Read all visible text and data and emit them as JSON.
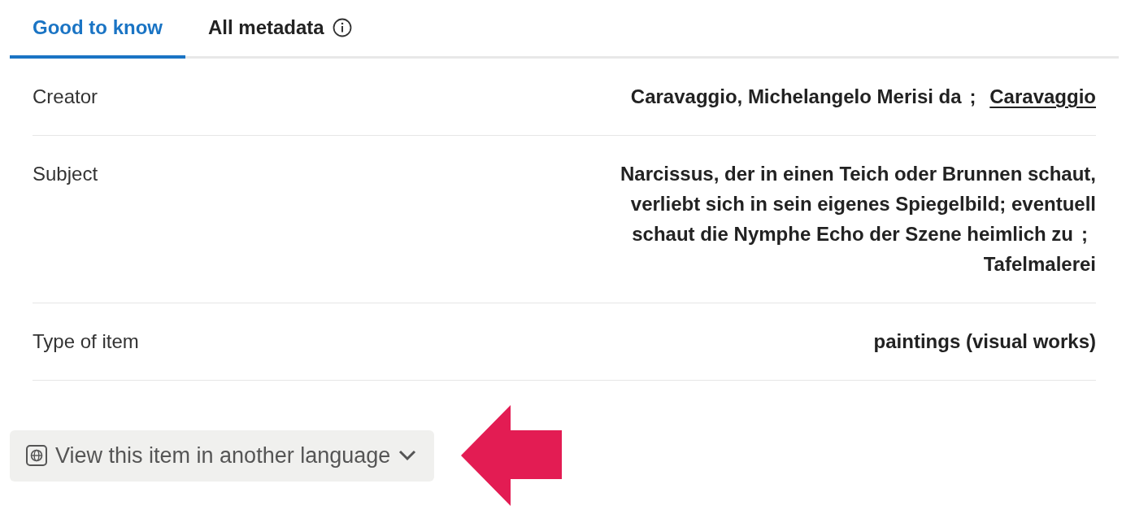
{
  "tabs": [
    {
      "label": "Good to know",
      "selected": true,
      "info": false
    },
    {
      "label": "All metadata",
      "selected": false,
      "info": true
    }
  ],
  "fields": [
    {
      "label": "Creator",
      "separator": ";",
      "values": [
        {
          "text": "Caravaggio, Michelangelo Merisi da",
          "link": false
        },
        {
          "text": "Caravaggio",
          "link": true
        }
      ]
    },
    {
      "label": "Subject",
      "separator": ";",
      "values": [
        {
          "text": "Narcissus, der in einen Teich oder Brunnen schaut, verliebt sich in sein eigenes Spiegelbild; eventuell schaut die Nymphe Echo der Szene heimlich zu",
          "link": false
        },
        {
          "text": "Tafelmalerei",
          "link": false
        }
      ]
    },
    {
      "label": "Type of item",
      "values": [
        {
          "text": "paintings (visual works)",
          "link": false
        }
      ]
    }
  ],
  "language_button": {
    "label": "View this item in another language",
    "expanded": false
  },
  "annotations": [
    {
      "kind": "arrow"
    }
  ]
}
